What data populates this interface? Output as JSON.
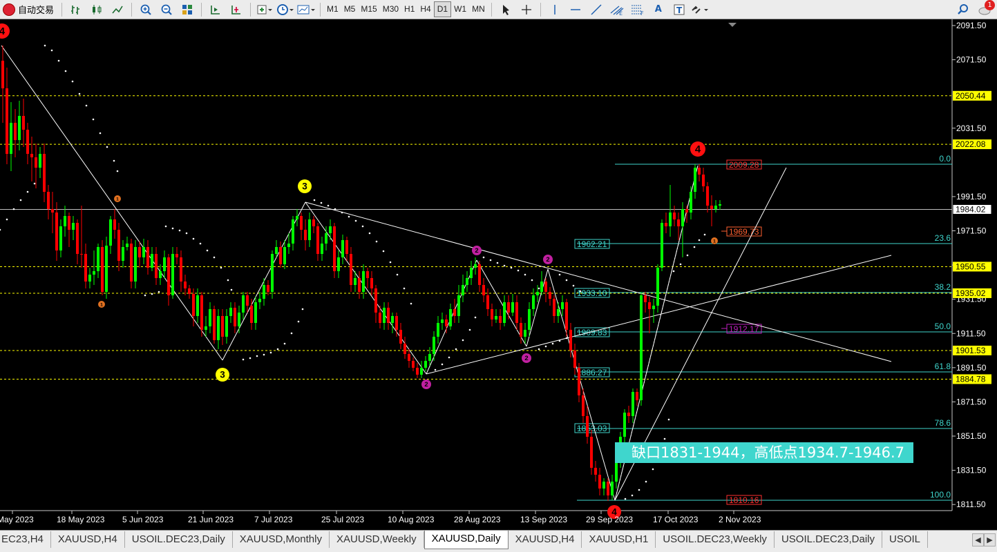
{
  "toolbar": {
    "auto_trade_label": "自动交易",
    "timeframes": [
      "M1",
      "M5",
      "M15",
      "M30",
      "H1",
      "H4",
      "D1",
      "W1",
      "MN"
    ],
    "active_timeframe": "D1",
    "text_tool": "A",
    "alert_count": "1"
  },
  "chart": {
    "symbol": "XAUUSD",
    "timeframe": "Daily",
    "price_axis": {
      "ticks": [
        "2091.50",
        "2071.50",
        "2031.50",
        "1991.50",
        "1971.50",
        "1951.50",
        "1931.50",
        "1911.50",
        "1891.50",
        "1871.50",
        "1851.50",
        "1831.50",
        "1811.50"
      ],
      "current_price": "1984.02",
      "levels": [
        "2050.44",
        "2022.08",
        "1950.55",
        "1935.02",
        "1901.53",
        "1884.78"
      ]
    },
    "date_axis": [
      "May 2023",
      "18 May 2023",
      "5 Jun 2023",
      "21 Jun 2023",
      "7 Jul 2023",
      "25 Jul 2023",
      "10 Aug 2023",
      "28 Aug 2023",
      "13 Sep 2023",
      "29 Sep 2023",
      "17 Oct 2023",
      "2 Nov 2023"
    ],
    "fibo_ratios": [
      "0.0",
      "23.6",
      "38.2",
      "50.0",
      "61.8",
      "78.6",
      "100.0"
    ],
    "fibo_price_labels": [
      "2009.28",
      "1962.21",
      "1933.10",
      "1909.83",
      "1886.27",
      "1853.03",
      "1810.16"
    ],
    "side_labels": [
      "1969.73",
      "1912.17"
    ],
    "wave_labels": {
      "four": "4",
      "three": "3",
      "two": "2",
      "one": "1"
    },
    "annotation": "缺口1831-1944，高低点1934.7-1946.7",
    "colors": {
      "bull": "#00ff00",
      "bear": "#ff0000",
      "fibo": "#3fd6cd",
      "level": "#ffff00",
      "background": "#000000"
    }
  },
  "tabs": [
    "EC23,H4",
    "XAUUSD,H4",
    "USOIL.DEC23,Daily",
    "XAUUSD,Monthly",
    "XAUUSD,Weekly",
    "XAUUSD,Daily",
    "XAUUSD,H4",
    "XAUUSD,H1",
    "USOIL.DEC23,Weekly",
    "USOIL.DEC23,Daily",
    "USOIL"
  ],
  "active_tab": "XAUUSD,Daily"
}
